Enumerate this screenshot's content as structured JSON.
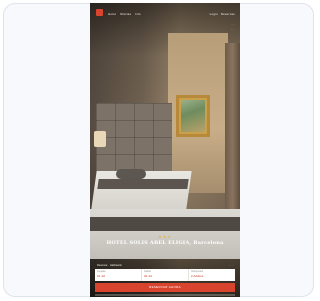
{
  "nav": {
    "home_label": "Hotel",
    "offers_label": "Ofertas",
    "info_label": "Info",
    "right_label_1": "Login",
    "right_label_2": "Reservas",
    "sub_link_1": "· · ·",
    "sub_link_2": "· · ·"
  },
  "hotel": {
    "stars": "★★★",
    "name": "HOTEL SOLIS ABEL ELIGIA, Barcelona"
  },
  "booking": {
    "header_label": "Reservar · Habitación",
    "header_right": "· · ·",
    "fields": [
      {
        "label": "Llegada",
        "value": "01 Jul"
      },
      {
        "label": "Salida",
        "value": "02 Jul"
      },
      {
        "label": "Huéspedes",
        "value": "2 Adultos"
      }
    ],
    "button_label": "RESERVAR AHORA"
  },
  "colors": {
    "accent": "#d9442f",
    "star": "#e0b64c"
  }
}
